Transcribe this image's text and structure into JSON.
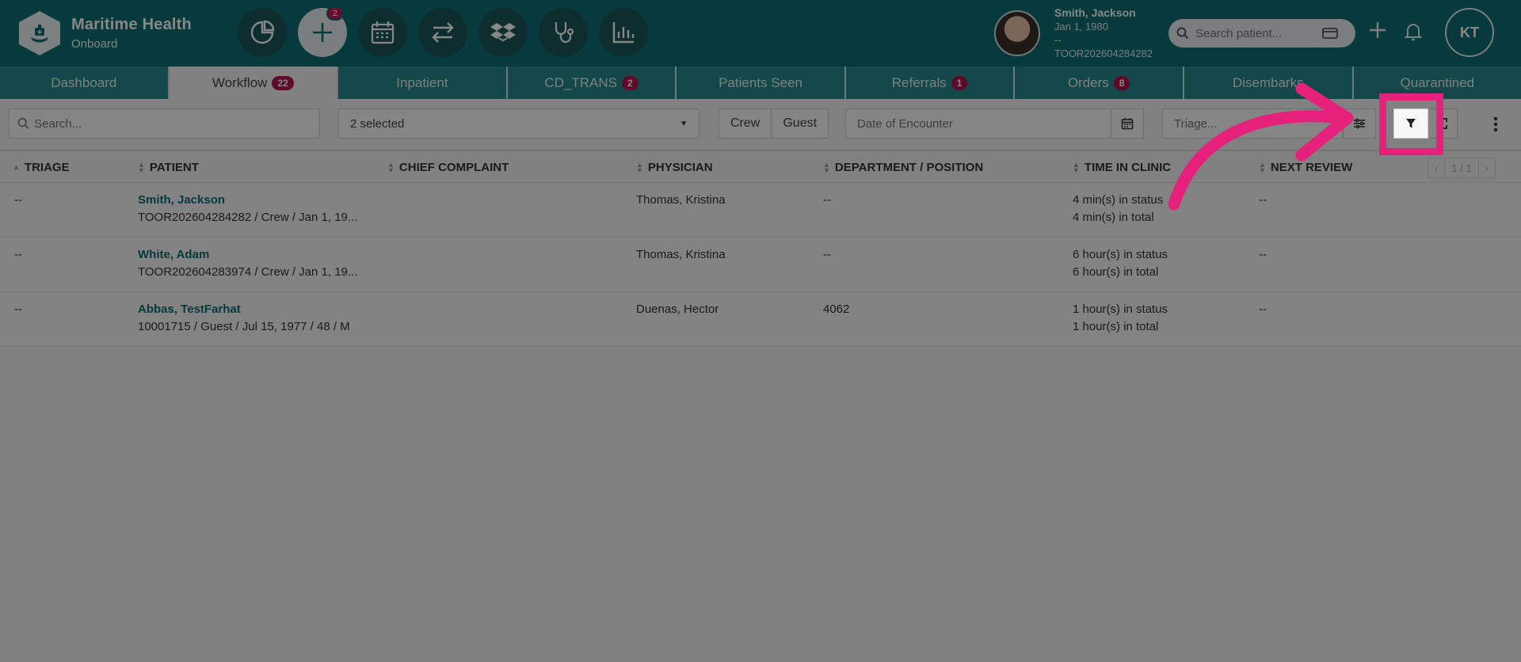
{
  "brand": {
    "name": "Maritime Health",
    "subtitle": "Onboard"
  },
  "nav": {
    "icons": [
      "pie-chart-icon",
      "plus-icon",
      "calendar-icon",
      "transfer-arrows-icon",
      "dropbox-icon",
      "stethoscope-icon",
      "bar-chart-icon"
    ],
    "add_badge": "2"
  },
  "patient": {
    "name": "Smith, Jackson",
    "dob": "Jan 1, 1980",
    "extra": "--",
    "id": "TOOR202604284282"
  },
  "search": {
    "placeholder": "Search patient..."
  },
  "user": {
    "initials": "KT"
  },
  "tabs": [
    {
      "label": "Dashboard",
      "badge": ""
    },
    {
      "label": "Workflow",
      "badge": "22"
    },
    {
      "label": "Inpatient",
      "badge": ""
    },
    {
      "label": "CD_TRANS",
      "badge": "2"
    },
    {
      "label": "Patients Seen",
      "badge": ""
    },
    {
      "label": "Referrals",
      "badge": "1"
    },
    {
      "label": "Orders",
      "badge": "8"
    },
    {
      "label": "Disembarks",
      "badge": ""
    },
    {
      "label": "Quarantined",
      "badge": ""
    }
  ],
  "filters": {
    "search_placeholder": "Search...",
    "selected_label": "2 selected",
    "crew_label": "Crew",
    "guest_label": "Guest",
    "date_placeholder": "Date of Encounter",
    "triage_placeholder": "Triage..."
  },
  "table": {
    "headers": [
      "TRIAGE",
      "PATIENT",
      "CHIEF COMPLAINT",
      "PHYSICIAN",
      "DEPARTMENT / POSITION",
      "TIME IN CLINIC",
      "NEXT REVIEW"
    ],
    "pager": "1 / 1",
    "rows": [
      {
        "triage": "--",
        "name": "Smith, Jackson",
        "detail": "TOOR202604284282 / Crew / Jan 1, 19...",
        "physician": "Thomas, Kristina",
        "department": "--",
        "time_status": "4 min(s) in status",
        "time_total": "4 min(s) in total",
        "next_review": "--"
      },
      {
        "triage": "--",
        "name": "White, Adam",
        "detail": "TOOR202604283974 / Crew / Jan 1, 19...",
        "physician": "Thomas, Kristina",
        "department": "--",
        "time_status": "6 hour(s) in status",
        "time_total": "6 hour(s) in total",
        "next_review": "--"
      },
      {
        "triage": "--",
        "name": "Abbas, TestFarhat",
        "detail": "10001715 / Guest / Jul 15, 1977 / 48 / M",
        "physician": "Duenas, Hector",
        "department": "4062",
        "time_status": "1 hour(s) in status",
        "time_total": "1 hour(s) in total",
        "next_review": "--"
      }
    ]
  },
  "colors": {
    "header": "#0e6f72",
    "tabs": "#27878a",
    "badge": "#b0144f",
    "highlight": "#e5217c"
  }
}
